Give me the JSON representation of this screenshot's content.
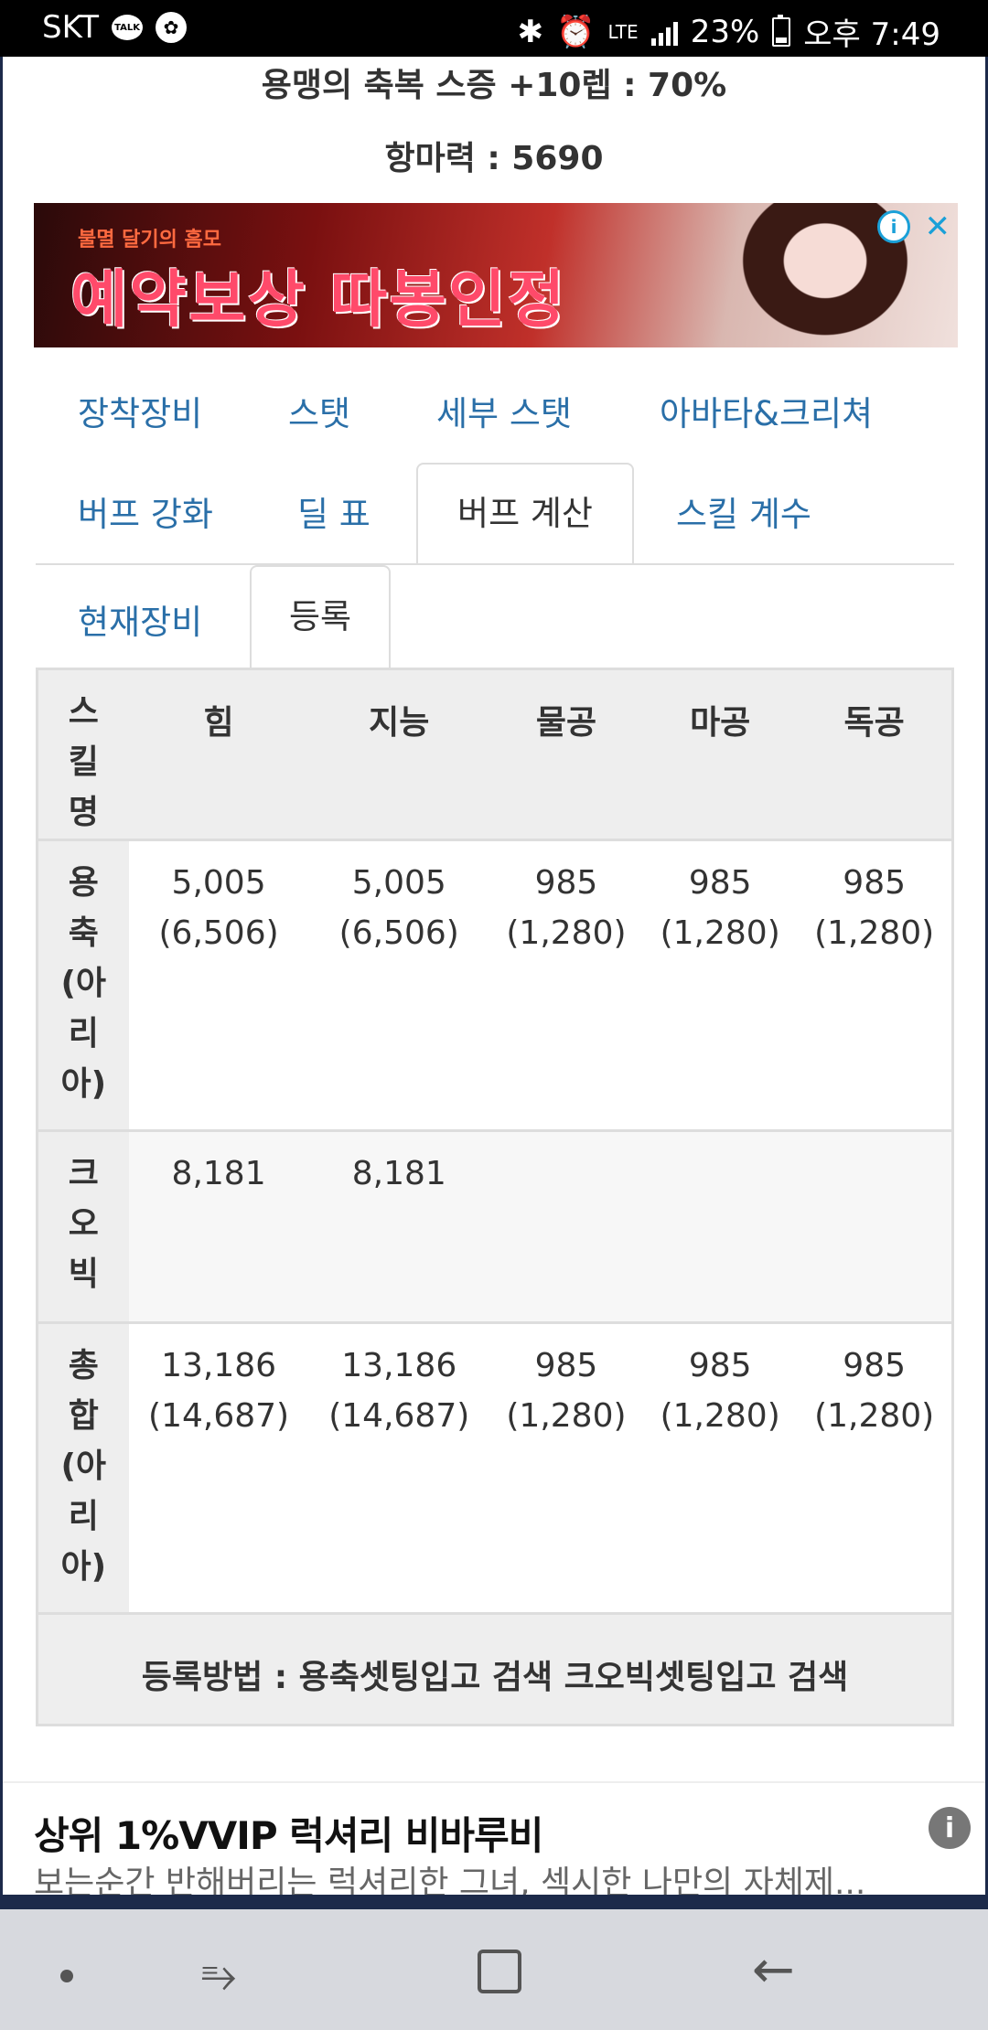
{
  "status_bar": {
    "carrier": "SKT",
    "talk_badge": "TALK",
    "network": "LTE",
    "battery": "23%",
    "time": "오후 7:49"
  },
  "header": {
    "line1": "용맹의 축복 스증 +10렙 : 70%",
    "line2": "항마력 : 5690"
  },
  "banner": {
    "subtitle": "불멸 달기의 흠모",
    "headline": "예약보상 따봉인정",
    "close_symbol": "✕",
    "info_symbol": "i"
  },
  "tabs_row1": [
    "장착장비",
    "스탯",
    "세부 스탯",
    "아바타&크리쳐"
  ],
  "tabs_row2": [
    "버프 강화",
    "딜 표",
    "버프 계산",
    "스킬 계수"
  ],
  "subtabs": [
    "현재장비",
    "등록"
  ],
  "table": {
    "name_header": [
      "스",
      "킬",
      "명"
    ],
    "headers": [
      "힘",
      "지능",
      "물공",
      "마공",
      "독공"
    ],
    "rows": [
      {
        "name": [
          "용",
          "축",
          "(아",
          "리",
          "아)"
        ],
        "cells": [
          [
            "5,005",
            "(6,506)"
          ],
          [
            "5,005",
            "(6,506)"
          ],
          [
            "985",
            "(1,280)"
          ],
          [
            "985",
            "(1,280)"
          ],
          [
            "985",
            "(1,280)"
          ]
        ]
      },
      {
        "name": [
          "크",
          "오",
          "빅"
        ],
        "cells": [
          [
            "8,181"
          ],
          [
            "8,181"
          ],
          [],
          [],
          []
        ]
      },
      {
        "name": [
          "총",
          "합",
          "(아",
          "리",
          "아)"
        ],
        "cells": [
          [
            "13,186",
            "(14,687)"
          ],
          [
            "13,186",
            "(14,687)"
          ],
          [
            "985",
            "(1,280)"
          ],
          [
            "985",
            "(1,280)"
          ],
          [
            "985",
            "(1,280)"
          ]
        ]
      }
    ],
    "footer": "등록방법 : 용축셋팅입고 검색 크오빅셋팅입고 검색"
  },
  "ad": {
    "title": "상위 1%VVIP 럭셔리 비바루비",
    "description": "보는순간 반해버리는 럭셔리한 그녀, 섹시한 나만의 자체제...",
    "info_symbol": "i"
  },
  "colors": {
    "link": "#2a6fa8",
    "header_bg": "#eeeeee",
    "border": "#dddddd"
  }
}
